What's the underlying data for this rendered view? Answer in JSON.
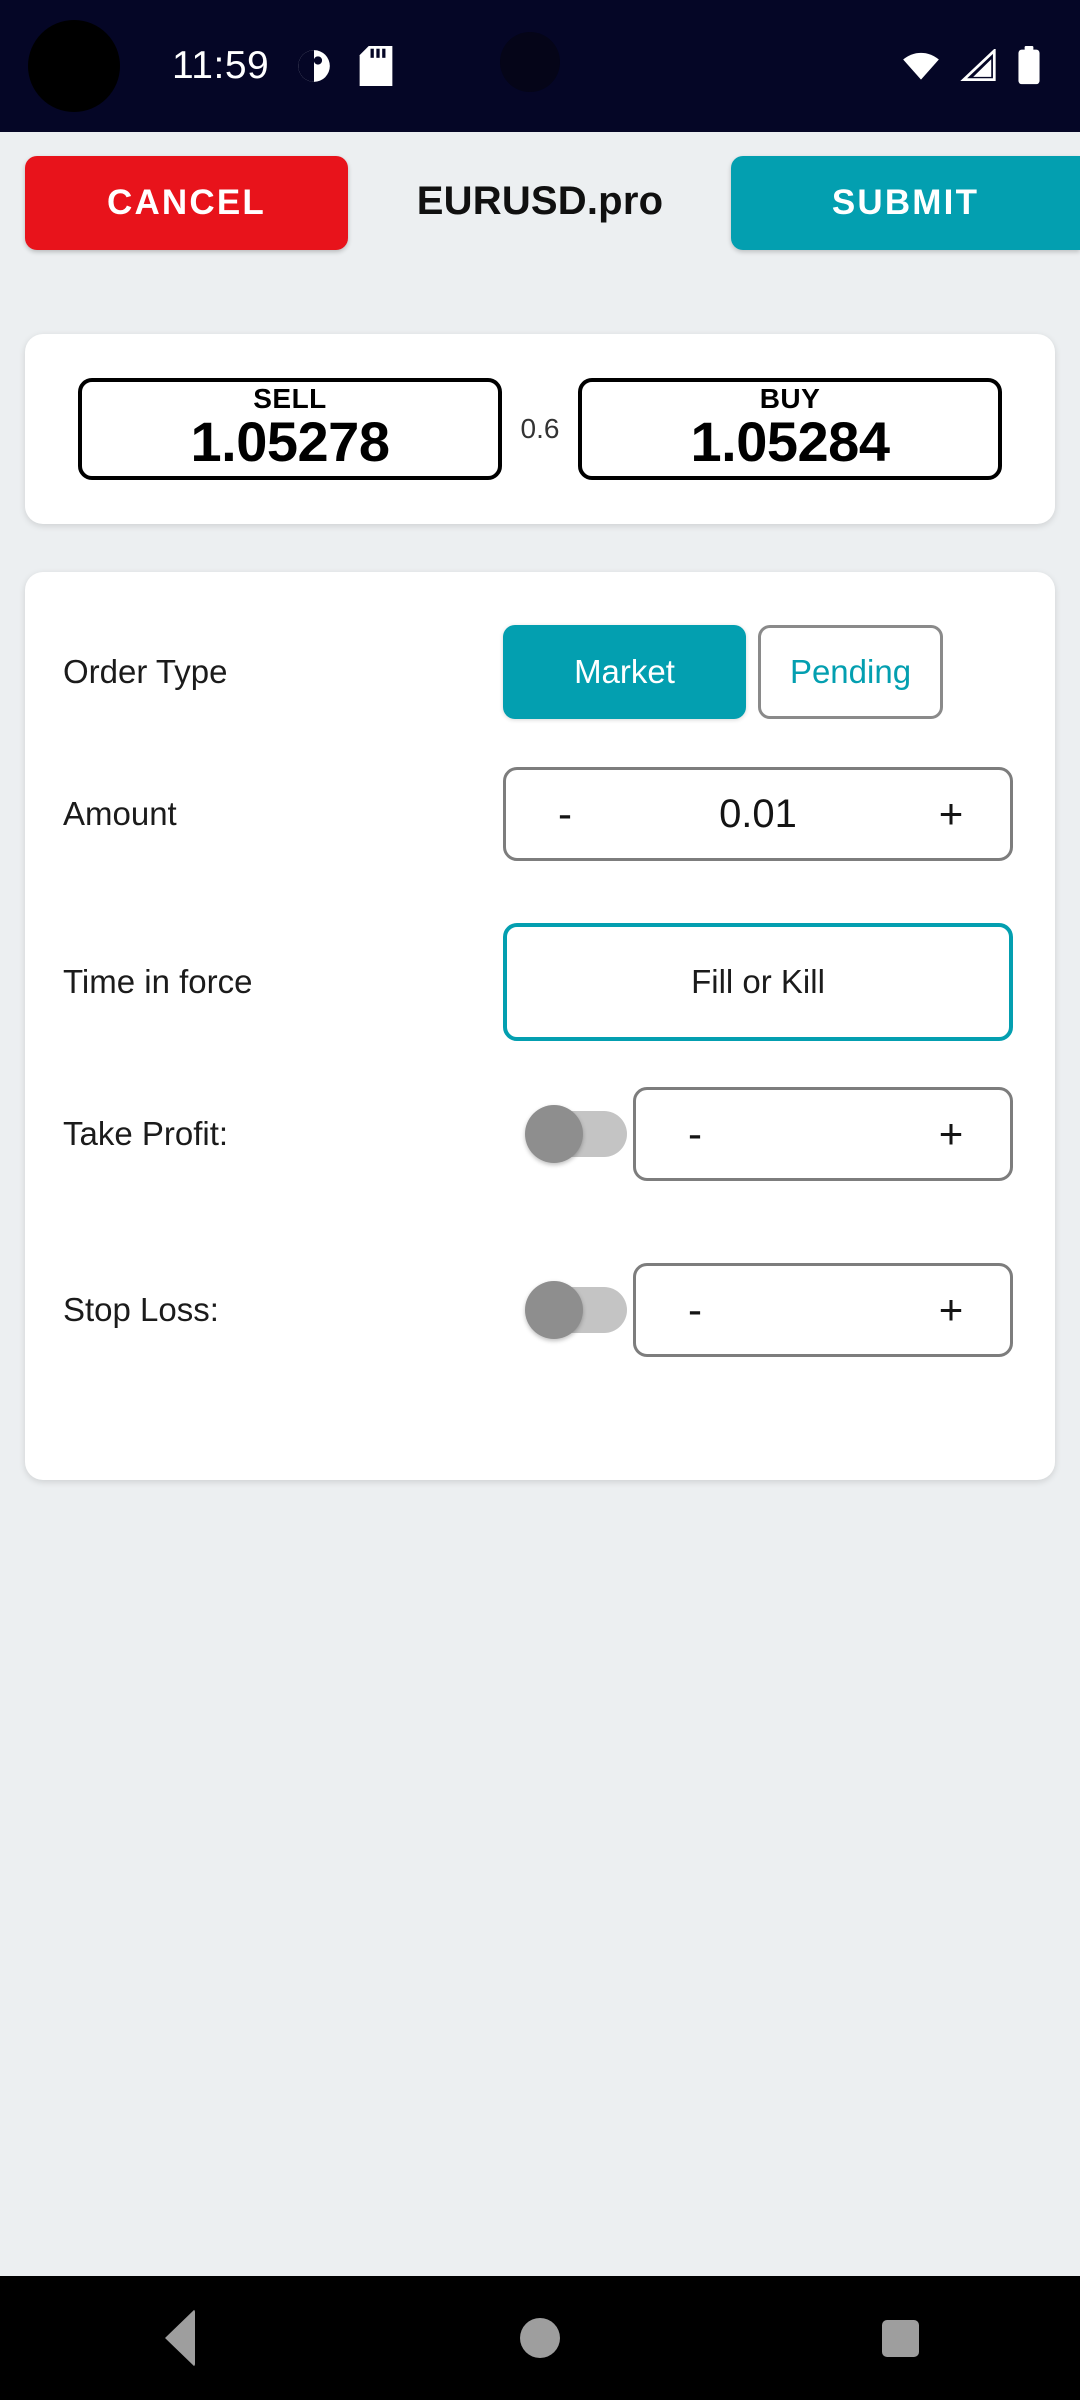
{
  "status_bar": {
    "time": "11:59",
    "icons_left": [
      "app-circle-icon",
      "sd-card-icon"
    ],
    "icons_right": [
      "wifi-icon",
      "cellular-signal-icon",
      "battery-icon"
    ],
    "background_color": "#050626"
  },
  "toolbar": {
    "cancel_label": "CANCEL",
    "submit_label": "SUBMIT",
    "symbol": "EURUSD.pro",
    "cancel_color": "#E8131B",
    "submit_color": "#039FB0"
  },
  "price_card": {
    "sell": {
      "label": "SELL",
      "value": "1.05278"
    },
    "spread": "0.6",
    "buy": {
      "label": "BUY",
      "value": "1.05284"
    }
  },
  "form": {
    "order_type": {
      "label": "Order Type",
      "options": [
        "Market",
        "Pending"
      ],
      "selected": "Market"
    },
    "amount": {
      "label": "Amount",
      "value": "0.01",
      "minus": "-",
      "plus": "+"
    },
    "time_in_force": {
      "label": "Time in force",
      "value": "Fill or Kill"
    },
    "take_profit": {
      "label": "Take Profit:",
      "enabled": false,
      "value": "",
      "minus": "-",
      "plus": "+"
    },
    "stop_loss": {
      "label": "Stop Loss:",
      "enabled": false,
      "value": "",
      "minus": "-",
      "plus": "+"
    }
  },
  "nav_bar": {
    "back": "back-icon",
    "home": "home-icon",
    "recents": "recents-icon"
  },
  "theme": {
    "accent": "#039FB0",
    "danger": "#E8131B",
    "background": "#ECEFF1",
    "card": "#FFFFFF"
  }
}
